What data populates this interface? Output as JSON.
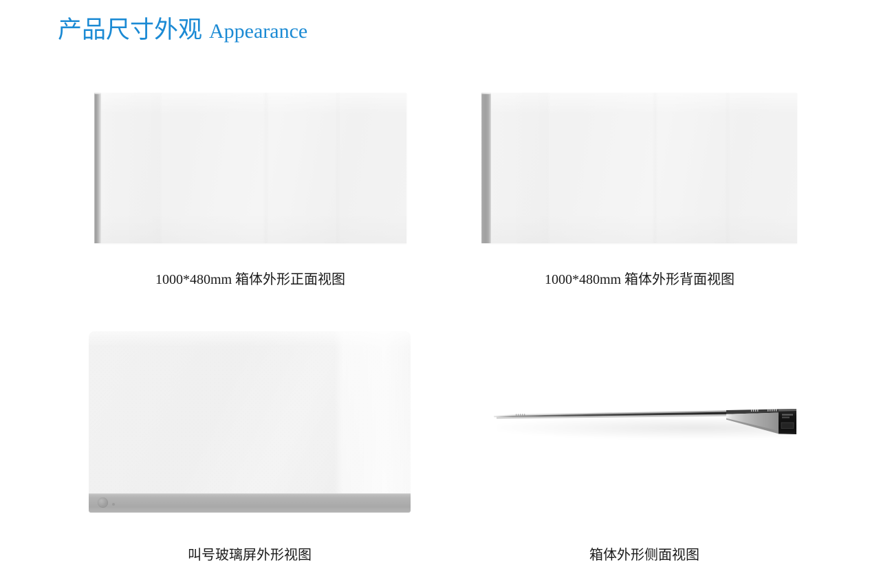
{
  "slide": {
    "title_cn": "产品尺寸外观",
    "title_en": "Appearance",
    "title_color": "#1b8ad4",
    "background_color": "#ffffff"
  },
  "figures": [
    {
      "id": "front-view",
      "caption": "1000*480mm 箱体外形正面视图",
      "icon": "cabinet-front-panel",
      "colors": {
        "face": "#f2f2f2",
        "edge": "#a0a0a0"
      },
      "dimensions_text": "1000*480mm"
    },
    {
      "id": "back-view",
      "caption": "1000*480mm 箱体外形背面视图",
      "icon": "cabinet-back-panel",
      "colors": {
        "face": "#f2f2f2",
        "edge": "#a6a6a6"
      },
      "dimensions_text": "1000*480mm"
    },
    {
      "id": "glass-screen-view",
      "caption": "叫号玻璃屏外形视图",
      "icon": "glass-call-screen",
      "colors": {
        "face": "#f1f1f1",
        "base": "#adadad"
      }
    },
    {
      "id": "side-view",
      "caption": "箱体外形侧面视图",
      "icon": "cabinet-side-profile",
      "colors": {
        "body": "#9b9b9b",
        "endcap": "#121212"
      }
    }
  ]
}
